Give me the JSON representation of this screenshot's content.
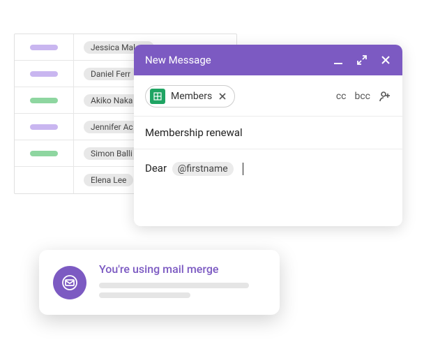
{
  "members": [
    {
      "status": "purple",
      "name": "Jessica Malora"
    },
    {
      "status": "purple",
      "name": "Daniel Ferr"
    },
    {
      "status": "green",
      "name": "Akiko Naka"
    },
    {
      "status": "purple",
      "name": "Jennifer Ac"
    },
    {
      "status": "green",
      "name": "Simon Balli"
    },
    {
      "status": "",
      "name": "Elena Lee"
    }
  ],
  "compose": {
    "title": "New Message",
    "recipient_chip_label": "Members",
    "cc_label": "cc",
    "bcc_label": "bcc",
    "subject": "Membership renewal",
    "body_greeting": "Dear",
    "merge_token": "@firstname"
  },
  "merge_card": {
    "title": "You're using mail merge"
  },
  "colors": {
    "brand_purple": "#7c5ac2",
    "sheets_green": "#1fa463",
    "status_purple": "#c9b6f0",
    "status_green": "#8ed6a0"
  }
}
